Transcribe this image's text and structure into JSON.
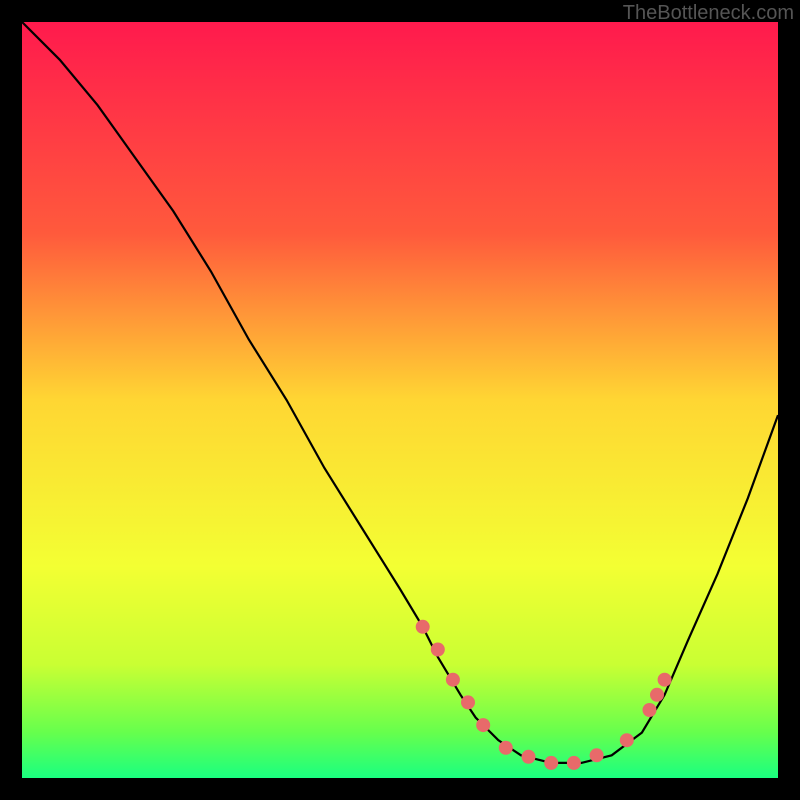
{
  "attribution": "TheBottleneck.com",
  "chart_data": {
    "type": "line",
    "title": "",
    "xlabel": "",
    "ylabel": "",
    "xlim": [
      0,
      100
    ],
    "ylim": [
      0,
      100
    ],
    "gradient_stops": [
      {
        "offset": 0,
        "color": "#ff1a4d"
      },
      {
        "offset": 28,
        "color": "#ff5a3c"
      },
      {
        "offset": 50,
        "color": "#ffd633"
      },
      {
        "offset": 72,
        "color": "#f3ff33"
      },
      {
        "offset": 85,
        "color": "#c9ff33"
      },
      {
        "offset": 94,
        "color": "#66ff4d"
      },
      {
        "offset": 100,
        "color": "#1aff80"
      }
    ],
    "curve": {
      "x": [
        0,
        5,
        10,
        15,
        20,
        25,
        30,
        35,
        40,
        45,
        50,
        53,
        55,
        58,
        60,
        63,
        66,
        70,
        74,
        78,
        82,
        85,
        88,
        92,
        96,
        100
      ],
      "y": [
        100,
        95,
        89,
        82,
        75,
        67,
        58,
        50,
        41,
        33,
        25,
        20,
        16,
        11,
        8,
        5,
        3,
        2,
        2,
        3,
        6,
        11,
        18,
        27,
        37,
        48
      ]
    },
    "markers": {
      "x": [
        53,
        55,
        57,
        59,
        61,
        64,
        67,
        70,
        73,
        76,
        80,
        83,
        84,
        85
      ],
      "y": [
        20,
        17,
        13,
        10,
        7,
        4,
        2.8,
        2,
        2,
        3,
        5,
        9,
        11,
        13
      ],
      "color": "#e86a6a",
      "radius": 7
    }
  }
}
